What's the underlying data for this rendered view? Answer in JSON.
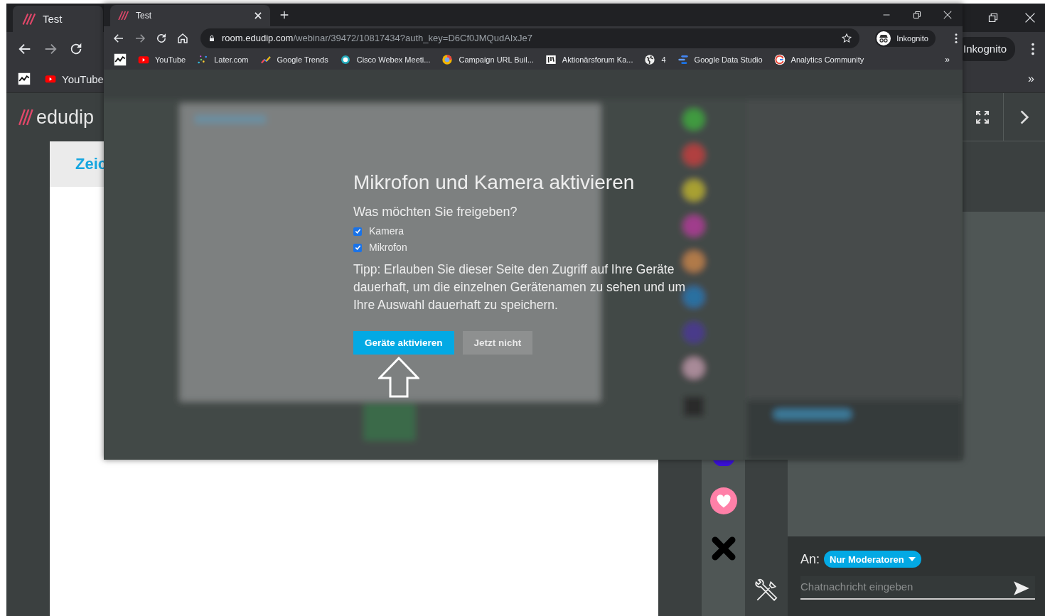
{
  "back_window": {
    "tab_title": "Test",
    "incognito_label": "Inkognito",
    "bookmarks": [
      {
        "kind": "chart"
      },
      {
        "kind": "youtube",
        "label": "YouTube"
      }
    ],
    "overflow": "»",
    "page": {
      "logo": "edudip",
      "heading": "Zeic",
      "chat": {
        "to_label": "An:",
        "recipient": "Nur Moderatoren",
        "placeholder": "Chatnachricht eingeben"
      }
    }
  },
  "front_window": {
    "tab_title": "Test",
    "url_host": "room.edudip.com",
    "url_path": "/webinar/39472/10817434?auth_key=D6Cf0JMQudAIxJe7",
    "incognito_label": "Inkognito",
    "bookmarks": [
      {
        "kind": "chart"
      },
      {
        "kind": "youtube",
        "label": "YouTube"
      },
      {
        "kind": "later",
        "label": "Later.com"
      },
      {
        "kind": "trends",
        "label": "Google Trends"
      },
      {
        "kind": "webex",
        "label": "Cisco Webex Meeti..."
      },
      {
        "kind": "campaign",
        "label": "Campaign URL Buil..."
      },
      {
        "kind": "book",
        "label": "Aktionärsforum Ka..."
      },
      {
        "kind": "globe",
        "label": "4"
      },
      {
        "kind": "datastudio",
        "label": "Google Data Studio"
      },
      {
        "kind": "google",
        "label": "Analytics Community"
      }
    ],
    "overflow": "»",
    "dialog": {
      "title": "Mikrofon und Kamera aktivieren",
      "question": "Was möchten Sie freigeben?",
      "options": [
        {
          "label": "Kamera",
          "checked": true
        },
        {
          "label": "Mikrofon",
          "checked": true
        }
      ],
      "tip": "Tipp: Erlauben Sie dieser Seite den Zugriff auf Ihre Geräte dauerhaft, um die einzelnen Gerätenamen zu sehen und um Ihre Auswahl dauerhaft zu speichern.",
      "buttons": [
        {
          "label": "Geräte aktivieren",
          "kind": "primary"
        },
        {
          "label": "Jetzt nicht",
          "kind": "secondary"
        }
      ]
    }
  }
}
